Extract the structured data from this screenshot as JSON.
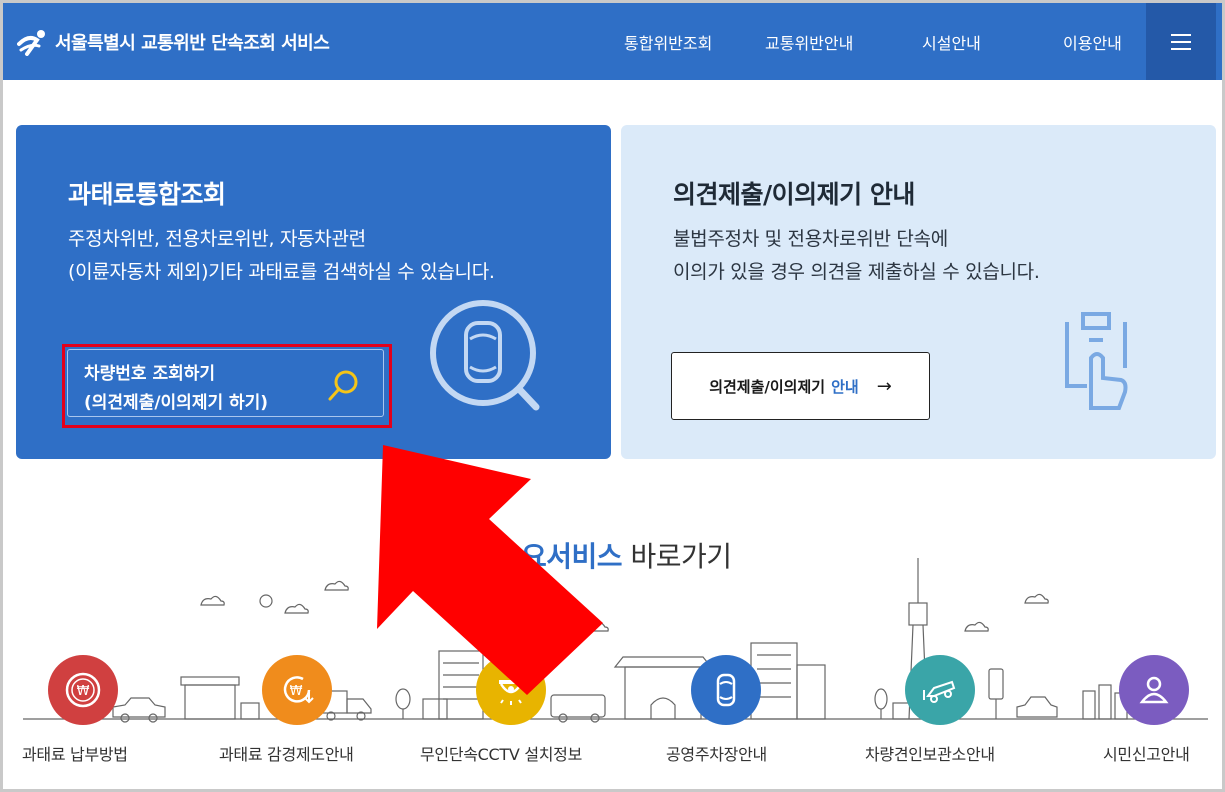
{
  "header": {
    "title": "서울특별시 교통위반 단속조회 서비스",
    "nav": [
      "통합위반조회",
      "교통위반안내",
      "시설안내",
      "이용안내"
    ],
    "brand_color": "#2f6fc6"
  },
  "card_search": {
    "title": "과태료통합조회",
    "desc_line1": "주정차위반, 전용차로위반, 자동차관련",
    "desc_line2": "(이륜자동차 제외)기타 과태료를 검색하실 수 있습니다.",
    "button_line1": "차량번호 조회하기",
    "button_line2": "(의견제출/이의제기 하기)"
  },
  "card_opinion": {
    "title": "의견제출/이의제기 안내",
    "desc_line1": "불법주정차 및 전용차로위반 단속에",
    "desc_line2": "이의가 있을 경우 의견을 제출하실 수 있습니다.",
    "button_text": "의견제출/이의제기",
    "button_accent": "안내",
    "button_arrow": "→"
  },
  "services": {
    "heading_bold": "요서비스",
    "heading_normal": " 바로가기",
    "items": [
      {
        "label": "과태료 납부방법",
        "icon": "won-coin-icon",
        "color": "#d04040"
      },
      {
        "label": "과태료 감경제도안내",
        "icon": "won-discount-icon",
        "color": "#f08c1c"
      },
      {
        "label": "무인단속CCTV 설치정보",
        "icon": "cctv-icon",
        "color": "#e8b400"
      },
      {
        "label": "공영주차장안내",
        "icon": "car-icon",
        "color": "#2f6fc6"
      },
      {
        "label": "차량견인보관소안내",
        "icon": "tow-car-icon",
        "color": "#3aa5a8"
      },
      {
        "label": "시민신고안내",
        "icon": "person-icon",
        "color": "#7b5cc0"
      }
    ]
  },
  "annotation": {
    "arrow_color": "#ff0000",
    "highlight_color": "#e3001b"
  }
}
